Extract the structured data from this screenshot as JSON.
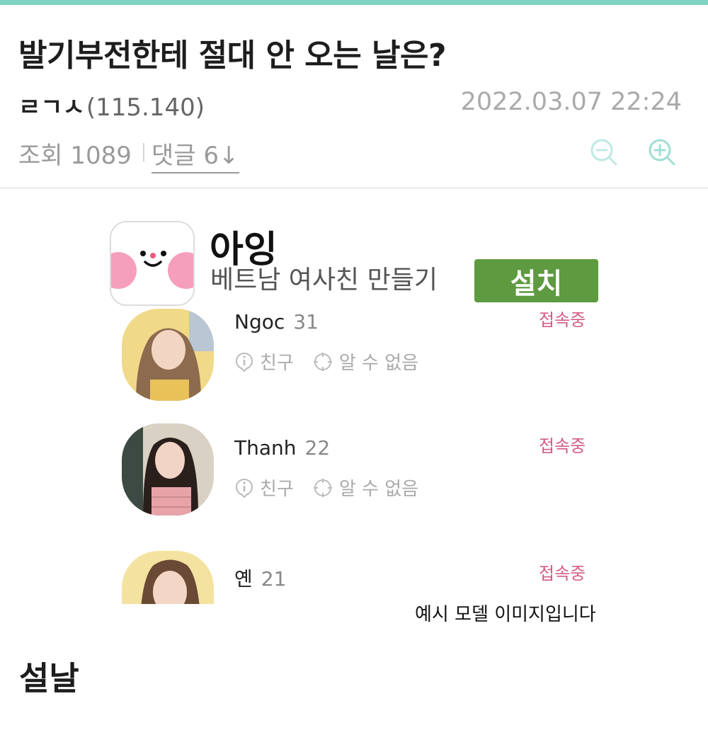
{
  "post": {
    "title": "발기부전한테 절대 안 오는 날은?",
    "author_nick": "ㄹㄱㅅ",
    "author_ip": "(115.140)",
    "timestamp": "2022.03.07 22:24",
    "views_label": "조회 1089",
    "comments_label": "댓글 6↓"
  },
  "colors": {
    "accent": "#7fd3c4",
    "install": "#5e9a3f",
    "online": "#d45d85"
  },
  "icons": {
    "zoom_out": "zoom-out-icon",
    "zoom_in": "zoom-in-icon",
    "info": "info-icon",
    "location": "location-icon"
  },
  "ad": {
    "app_name": "아잉",
    "description": "베트남 여사친 만들기",
    "install_label": "설치",
    "caption": "예시 모델 이미지입니다",
    "profiles": [
      {
        "name": "Ngoc",
        "age": "31",
        "status": "접속중",
        "tag1": "친구",
        "tag2": "알 수 없음"
      },
      {
        "name": "Thanh",
        "age": "22",
        "status": "접속중",
        "tag1": "친구",
        "tag2": "알 수 없음"
      },
      {
        "name": "옌",
        "age": "21",
        "status": "접속중"
      }
    ]
  },
  "body": {
    "heading": "설날"
  }
}
